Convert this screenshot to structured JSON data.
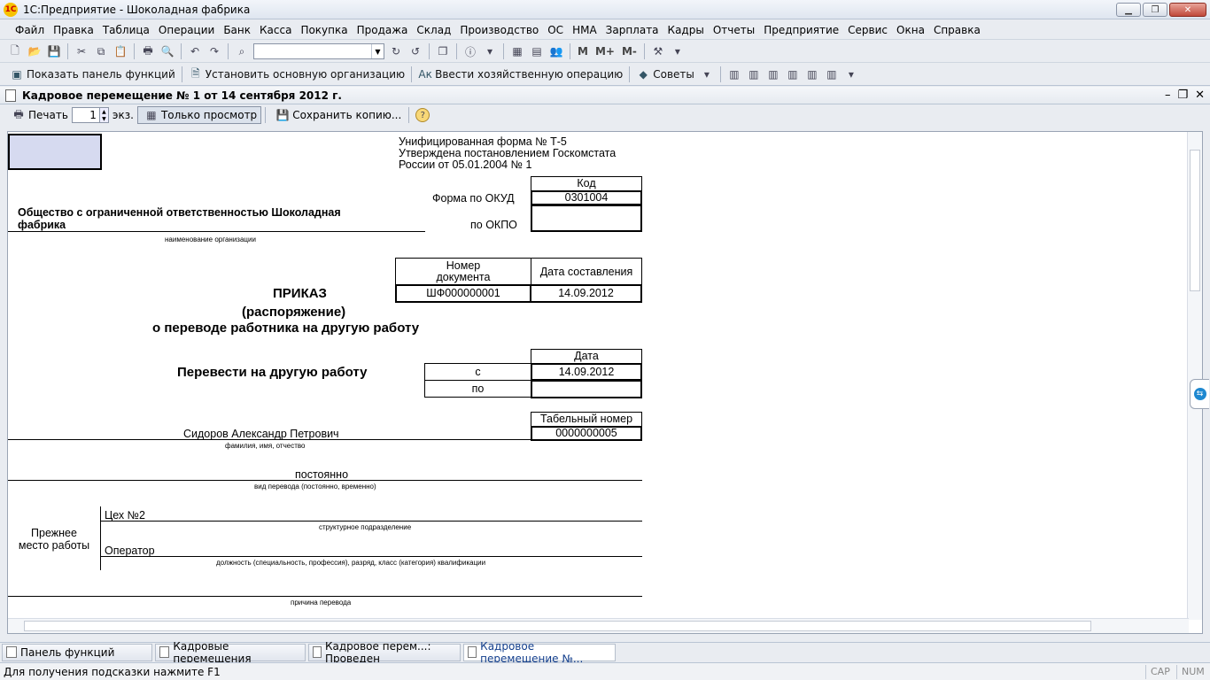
{
  "window": {
    "title": "1С:Предприятие - Шоколадная фабрика",
    "logo": "1С"
  },
  "menu": [
    "Файл",
    "Правка",
    "Таблица",
    "Операции",
    "Банк",
    "Касса",
    "Покупка",
    "Продажа",
    "Склад",
    "Производство",
    "ОС",
    "НМА",
    "Зарплата",
    "Кадры",
    "Отчеты",
    "Предприятие",
    "Сервис",
    "Окна",
    "Справка"
  ],
  "toolbar1": {
    "m": "M",
    "mplus": "M+",
    "mminus": "M-"
  },
  "toolbar2": {
    "show_panel": "Показать панель функций",
    "set_org": "Установить основную организацию",
    "enter_op": "Ввести хозяйственную операцию",
    "tips": "Советы"
  },
  "doc": {
    "title": "Кадровое перемещение  № 1 от 14 сентября 2012 г.",
    "print": "Печать",
    "copies": "1",
    "copies_unit": "экз.",
    "view_only": "Только просмотр",
    "save_copy": "Сохранить копию...",
    "help": "?"
  },
  "form": {
    "unified_1": "Унифицированная форма № Т-5",
    "unified_2": "Утверждена постановлением Госкомстата",
    "unified_3": "России от 05.01.2004 № 1",
    "kod": "Код",
    "okud_label": "Форма по ОКУД",
    "okud": "0301004",
    "okpo_label": "по ОКПО",
    "okpo": "",
    "org_name_1": "Общество с ограниченной ответственностью Шоколадная",
    "org_name_2": "фабрика",
    "org_caption": "наименование организации",
    "num_header_1": "Номер",
    "num_header_2": "документа",
    "date_header": "Дата составления",
    "doc_number": "ШФ000000001",
    "doc_date": "14.09.2012",
    "order_1": "ПРИКАЗ",
    "order_2": "(распоряжение)",
    "order_3": "о переводе работника на другую работу",
    "date_label": "Дата",
    "transfer": "Перевести на другую работу",
    "from_label": "с",
    "from_date": "14.09.2012",
    "to_label": "по",
    "to_date": "",
    "tab_header": "Табельный номер",
    "tab_number": "0000000005",
    "employee": "Сидоров Александр Петрович",
    "employee_caption": "фамилия, имя, отчество",
    "transfer_type": "постоянно",
    "transfer_caption": "вид перевода (постоянно, временно)",
    "prev_1": "Прежнее",
    "prev_2": "место работы",
    "dept": "Цех №2",
    "dept_caption": "структурное подразделение",
    "position": "Оператор",
    "position_caption": "должность (специальность, профессия), разряд, класс (категория) квалификации",
    "reason_caption": "причина перевода"
  },
  "tasks": [
    "Панель функций",
    "Кадровые перемещения",
    "Кадровое перем...: Проведен",
    "Кадровое перемещение  №..."
  ],
  "status": {
    "hint": "Для получения подсказки нажмите F1",
    "cap": "CAP",
    "num": "NUM"
  }
}
